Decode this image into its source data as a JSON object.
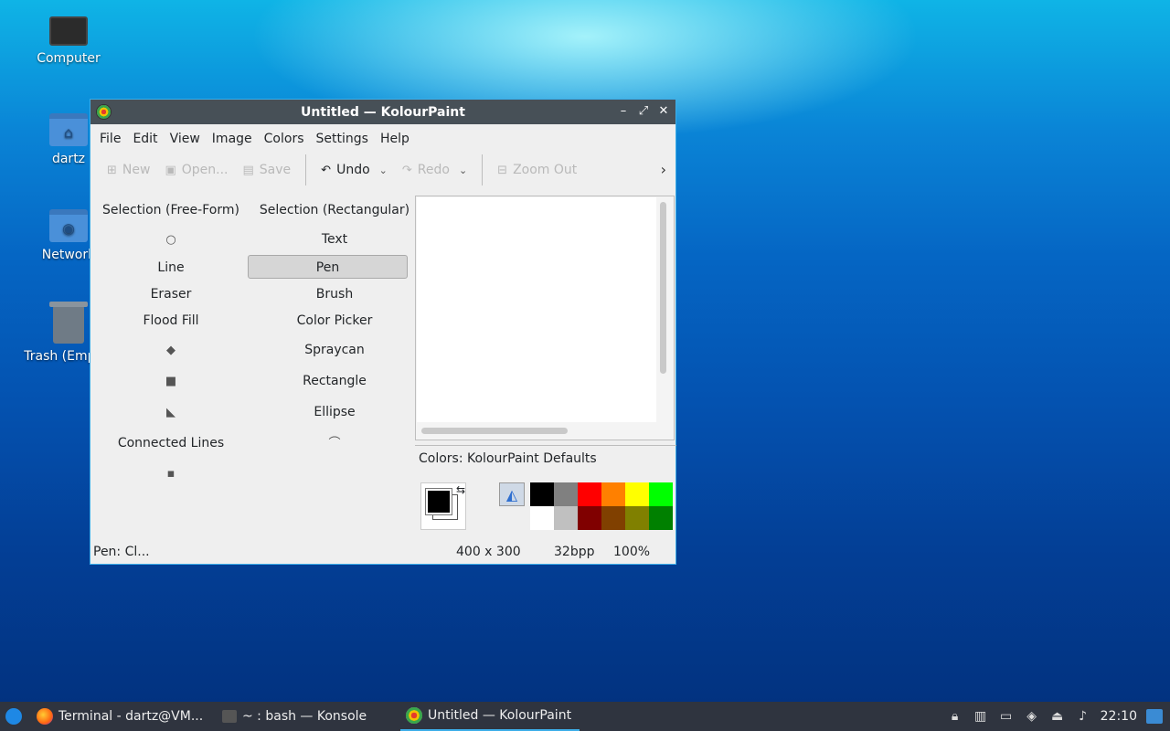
{
  "desktop": {
    "icons": [
      {
        "label": "Computer"
      },
      {
        "label": "dartz"
      },
      {
        "label": "Network"
      },
      {
        "label": "Trash (Empty)"
      }
    ]
  },
  "window": {
    "title": "Untitled  — KolourPaint",
    "controls": {
      "minimize": "–",
      "maximize": "⤢",
      "close": "✕"
    },
    "menu": [
      "File",
      "Edit",
      "View",
      "Image",
      "Colors",
      "Settings",
      "Help"
    ],
    "toolbar": {
      "new": "New",
      "open": "Open...",
      "save": "Save",
      "undo": "Undo",
      "redo": "Redo",
      "zoom_out": "Zoom Out",
      "more": "›"
    },
    "tools": {
      "selection_free": "Selection (Free-Form)",
      "selection_rect": "Selection (Rectangular)",
      "text": "Text",
      "line": "Line",
      "pen": "Pen",
      "eraser": "Eraser",
      "brush": "Brush",
      "flood_fill": "Flood Fill",
      "color_picker": "Color Picker",
      "spraycan": "Spraycan",
      "rectangle": "Rectangle",
      "ellipse": "Ellipse",
      "connected_lines": "Connected Lines"
    },
    "colors_title": "Colors: KolourPaint Defaults",
    "palette": {
      "row1": [
        "#000000",
        "#808080",
        "#ff0000",
        "#ff8000",
        "#ffff00",
        "#00ff00"
      ],
      "row2": [
        "#ffffff",
        "#c0c0c0",
        "#800000",
        "#804000",
        "#808000",
        "#008000"
      ]
    },
    "status": {
      "message": "Pen: Cl...",
      "dimensions": "400 x 300",
      "bpp": "32bpp",
      "zoom": "100%"
    }
  },
  "taskbar": {
    "tasks": [
      {
        "label": "Terminal - dartz@VM..."
      },
      {
        "label": "~ : bash — Konsole"
      },
      {
        "label": "Untitled  — KolourPaint"
      }
    ],
    "clock": "22:10"
  }
}
